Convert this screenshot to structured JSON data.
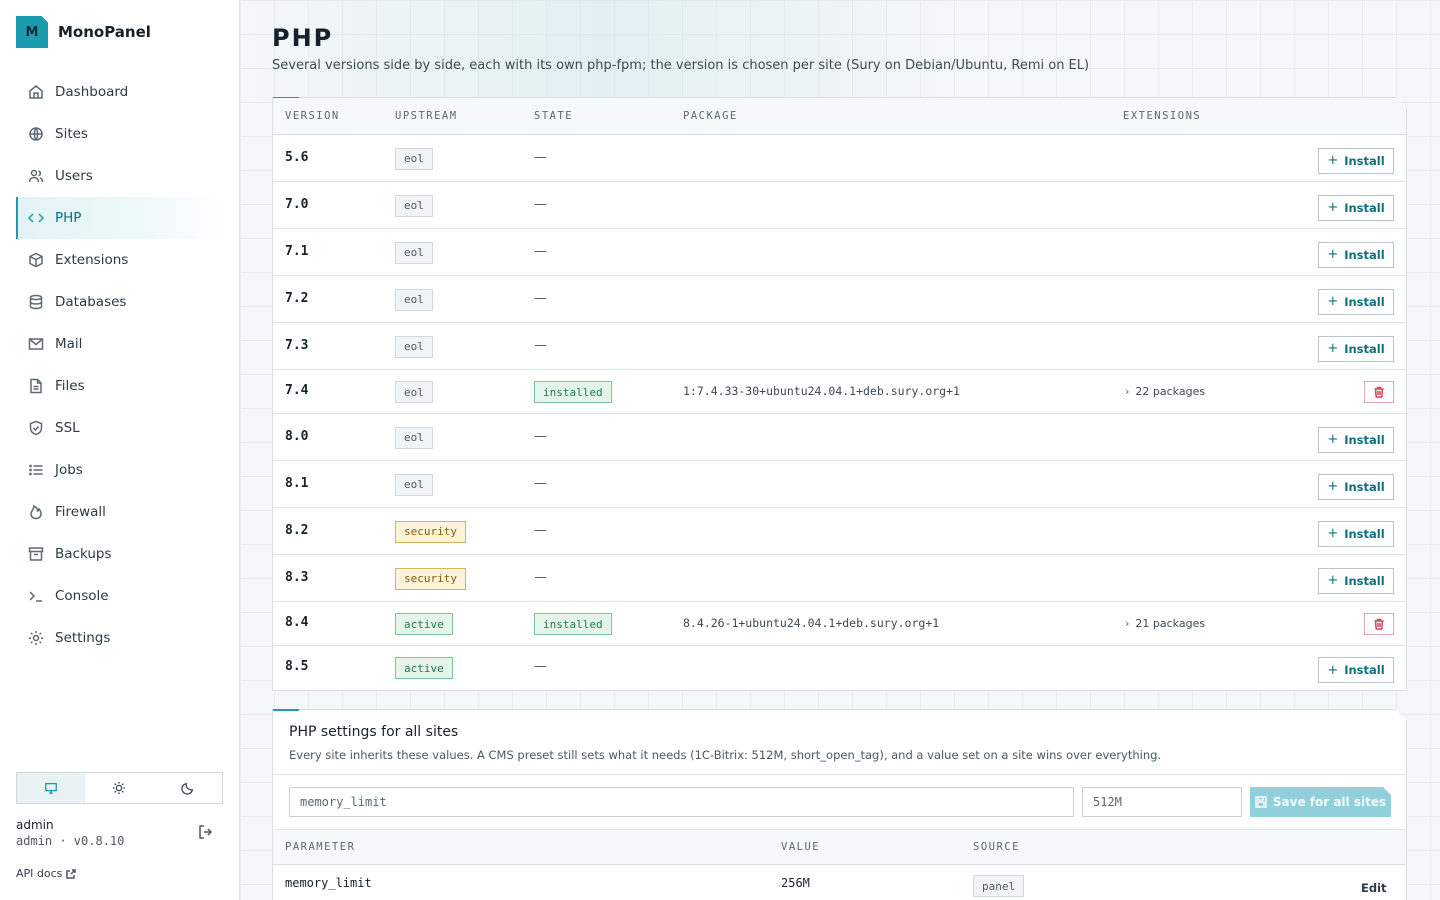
{
  "brand": {
    "logo_letter": "M",
    "name": "MonoPanel"
  },
  "nav": [
    {
      "label": "Dashboard",
      "icon": "home-icon",
      "active": false
    },
    {
      "label": "Sites",
      "icon": "globe-icon",
      "active": false
    },
    {
      "label": "Users",
      "icon": "users-icon",
      "active": false
    },
    {
      "label": "PHP",
      "icon": "code-icon",
      "active": true
    },
    {
      "label": "Extensions",
      "icon": "box-icon",
      "active": false
    },
    {
      "label": "Databases",
      "icon": "database-icon",
      "active": false
    },
    {
      "label": "Mail",
      "icon": "mail-icon",
      "active": false
    },
    {
      "label": "Files",
      "icon": "file-icon",
      "active": false
    },
    {
      "label": "SSL",
      "icon": "shield-icon",
      "active": false
    },
    {
      "label": "Jobs",
      "icon": "list-icon",
      "active": false
    },
    {
      "label": "Firewall",
      "icon": "flame-icon",
      "active": false
    },
    {
      "label": "Backups",
      "icon": "archive-icon",
      "active": false
    },
    {
      "label": "Console",
      "icon": "terminal-icon",
      "active": false
    },
    {
      "label": "Settings",
      "icon": "gear-icon",
      "active": false
    }
  ],
  "theme": {
    "options": [
      "monitor-icon",
      "sun-icon",
      "moon-icon"
    ],
    "selected": 0
  },
  "user": {
    "name": "admin",
    "meta": "admin · v0.8.10"
  },
  "api_docs": "API docs",
  "page": {
    "title": "PHP",
    "subtitle": "Several versions side by side, each with its own php-fpm; the version is chosen per site (Sury on Debian/Ubuntu, Remi on EL)"
  },
  "versions_table": {
    "headers": {
      "version": "VERSION",
      "upstream": "UPSTREAM",
      "state": "STATE",
      "package": "PACKAGE",
      "extensions": "EXTENSIONS"
    },
    "install_label": "Install",
    "dash": "—",
    "rows": [
      {
        "version": "5.6",
        "upstream": "eol",
        "state": "",
        "package": "",
        "extensions": ""
      },
      {
        "version": "7.0",
        "upstream": "eol",
        "state": "",
        "package": "",
        "extensions": ""
      },
      {
        "version": "7.1",
        "upstream": "eol",
        "state": "",
        "package": "",
        "extensions": ""
      },
      {
        "version": "7.2",
        "upstream": "eol",
        "state": "",
        "package": "",
        "extensions": ""
      },
      {
        "version": "7.3",
        "upstream": "eol",
        "state": "",
        "package": "",
        "extensions": ""
      },
      {
        "version": "7.4",
        "upstream": "eol",
        "state": "installed",
        "package": "1:7.4.33-30+ubuntu24.04.1+deb.sury.org+1",
        "extensions": "22 packages"
      },
      {
        "version": "8.0",
        "upstream": "eol",
        "state": "",
        "package": "",
        "extensions": ""
      },
      {
        "version": "8.1",
        "upstream": "eol",
        "state": "",
        "package": "",
        "extensions": ""
      },
      {
        "version": "8.2",
        "upstream": "security",
        "state": "",
        "package": "",
        "extensions": ""
      },
      {
        "version": "8.3",
        "upstream": "security",
        "state": "",
        "package": "",
        "extensions": ""
      },
      {
        "version": "8.4",
        "upstream": "active",
        "state": "installed",
        "package": "8.4.26-1+ubuntu24.04.1+deb.sury.org+1",
        "extensions": "21 packages"
      },
      {
        "version": "8.5",
        "upstream": "active",
        "state": "",
        "package": "",
        "extensions": ""
      }
    ]
  },
  "settings": {
    "title": "PHP settings for all sites",
    "subtitle": "Every site inherits these values. A CMS preset still sets what it needs (1C-Bitrix: 512M, short_open_tag), and a value set on a site wins over everything.",
    "param_placeholder": "memory_limit",
    "value_placeholder": "512M",
    "save_label": "Save for all sites",
    "headers": {
      "parameter": "PARAMETER",
      "value": "VALUE",
      "source": "SOURCE"
    },
    "rows": [
      {
        "parameter": "memory_limit",
        "value": "256M",
        "source": "panel",
        "action": "Edit"
      }
    ]
  },
  "colors": {
    "accent": "#1a9bb0",
    "danger": "#d0465a"
  }
}
